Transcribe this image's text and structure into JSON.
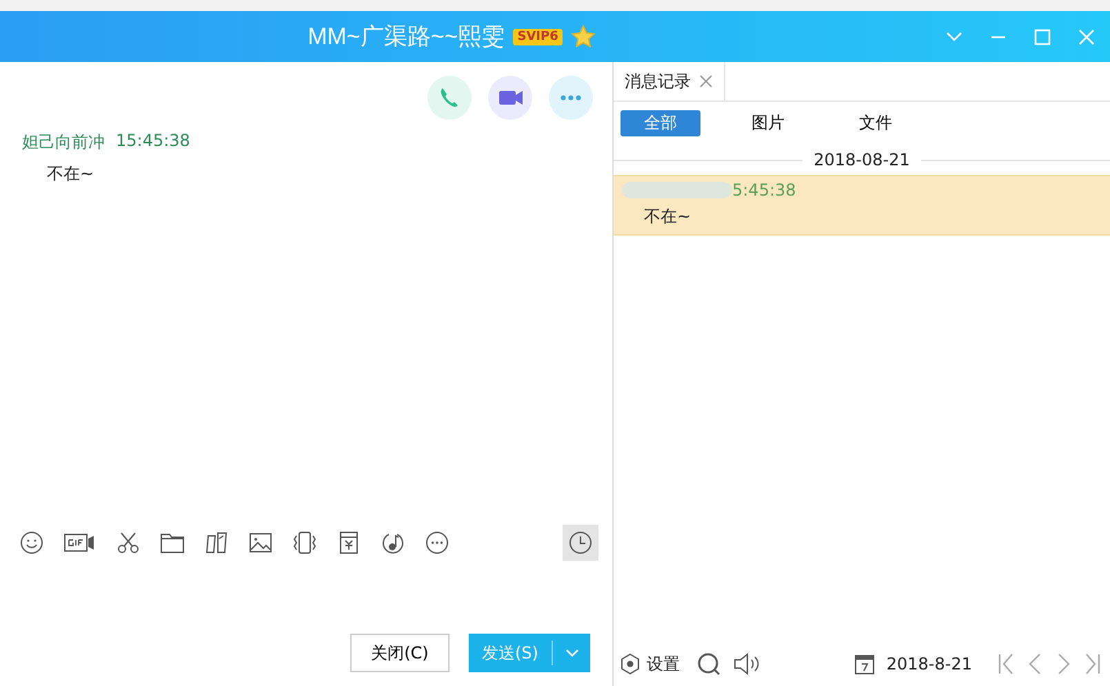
{
  "window": {
    "title": "MM~广渠路~~熙雯",
    "badge": "SVIP6"
  },
  "chat": {
    "messages": [
      {
        "sender": "妲己向前冲",
        "time": "15:45:38",
        "text": "不在~"
      }
    ]
  },
  "composer": {
    "close_button": "关闭(C)",
    "send_button": "发送(S)"
  },
  "history": {
    "tab": "消息记录",
    "filters": [
      {
        "label": "全部",
        "selected": true
      },
      {
        "label": "图片",
        "selected": false
      },
      {
        "label": "文件",
        "selected": false
      }
    ],
    "date": "2018-08-21",
    "entries": [
      {
        "time": "5:45:38",
        "text": "不在~",
        "highlighted": true
      }
    ],
    "footer": {
      "settings": "设置",
      "date": "2018-8-21"
    }
  }
}
